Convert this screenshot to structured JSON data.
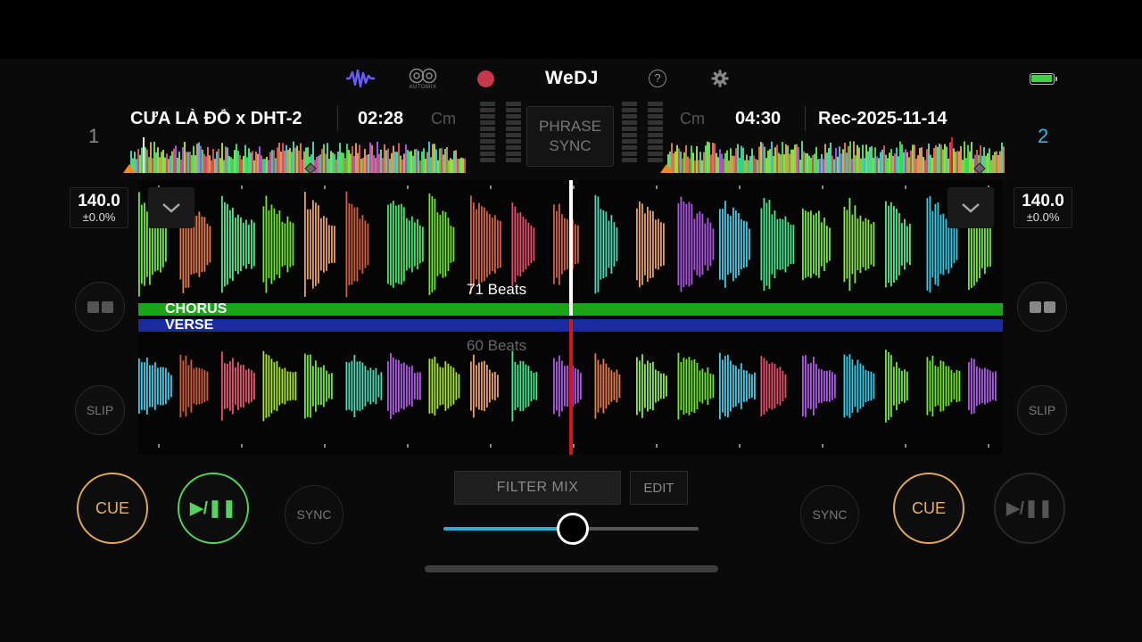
{
  "app": {
    "brand": "WeDJ"
  },
  "toolbar": {
    "automix_label": "AUTOMIX",
    "help_symbol": "?"
  },
  "deck1": {
    "number": "1",
    "title": "CƯA LÀ ĐỖ x DHT-2",
    "time": "02:28",
    "key": "Cm",
    "bpm": "140.0",
    "pitch": "±0.0%",
    "cue_label": "CUE",
    "play_label": "▶/❚❚",
    "sync_label": "SYNC",
    "slip_label": "SLIP",
    "beats": "71 Beats",
    "playing": true
  },
  "deck2": {
    "number": "2",
    "title": "Rec-2025-11-14",
    "time": "04:30",
    "key": "Cm",
    "bpm": "140.0",
    "pitch": "±0.0%",
    "cue_label": "CUE",
    "play_label": "▶/❚❚",
    "sync_label": "SYNC",
    "slip_label": "SLIP",
    "beats": "60 Beats",
    "playing": false
  },
  "center": {
    "phrase_sync_line1": "PHRASE",
    "phrase_sync_line2": "SYNC",
    "filter_mix_label": "FILTER MIX",
    "edit_label": "EDIT",
    "crossfader_position": 0.5
  },
  "phrases": {
    "chorus": "CHORUS",
    "verse": "VERSE"
  },
  "colors": {
    "accent_blue": "#3ab4e8",
    "cue_orange": "#e0a85a",
    "play_green": "#56d25f",
    "chorus_green": "#1aa516",
    "verse_blue": "#1c2aa0",
    "record_red": "#c5394a",
    "waveform_icon": "#6a5cff"
  }
}
